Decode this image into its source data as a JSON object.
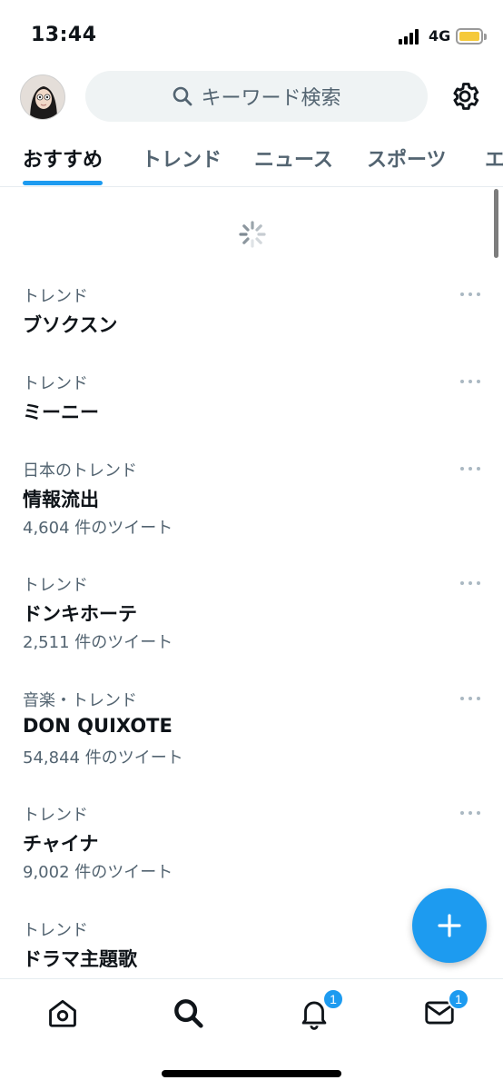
{
  "status_bar": {
    "time": "13:44",
    "network": "4G",
    "signal_icon": "signal-bars-icon",
    "battery_icon": "battery-icon",
    "battery_color": "#f5c93a"
  },
  "header": {
    "avatar_icon": "profile-avatar",
    "search_placeholder": "キーワード検索",
    "search_icon": "search-icon",
    "settings_icon": "gear-icon"
  },
  "tabs": [
    {
      "label": "おすすめ",
      "active": true
    },
    {
      "label": "トレンド",
      "active": false
    },
    {
      "label": "ニュース",
      "active": false
    },
    {
      "label": "スポーツ",
      "active": false
    },
    {
      "label": "エ",
      "active": false
    }
  ],
  "trends": [
    {
      "category": "トレンド",
      "title": "ブソクスン",
      "count": ""
    },
    {
      "category": "トレンド",
      "title": "ミーニー",
      "count": ""
    },
    {
      "category": "日本のトレンド",
      "title": "情報流出",
      "count": "4,604 件のツイート"
    },
    {
      "category": "トレンド",
      "title": "ドンキホーテ",
      "count": "2,511 件のツイート"
    },
    {
      "category": "音楽・トレンド",
      "title": "DON QUIXOTE",
      "count": "54,844 件のツイート"
    },
    {
      "category": "トレンド",
      "title": "チャイナ",
      "count": "9,002 件のツイート"
    },
    {
      "category": "トレンド",
      "title": "ドラマ主題歌",
      "count": ""
    }
  ],
  "fab": {
    "icon": "plus-icon"
  },
  "bottom_nav": {
    "home_icon": "home-icon",
    "search_icon": "search-icon",
    "notifications_icon": "bell-icon",
    "notifications_badge": "1",
    "messages_icon": "mail-icon",
    "messages_badge": "1"
  },
  "colors": {
    "accent": "#1d9bf0",
    "text_primary": "#0f1419",
    "text_secondary": "#536471"
  }
}
